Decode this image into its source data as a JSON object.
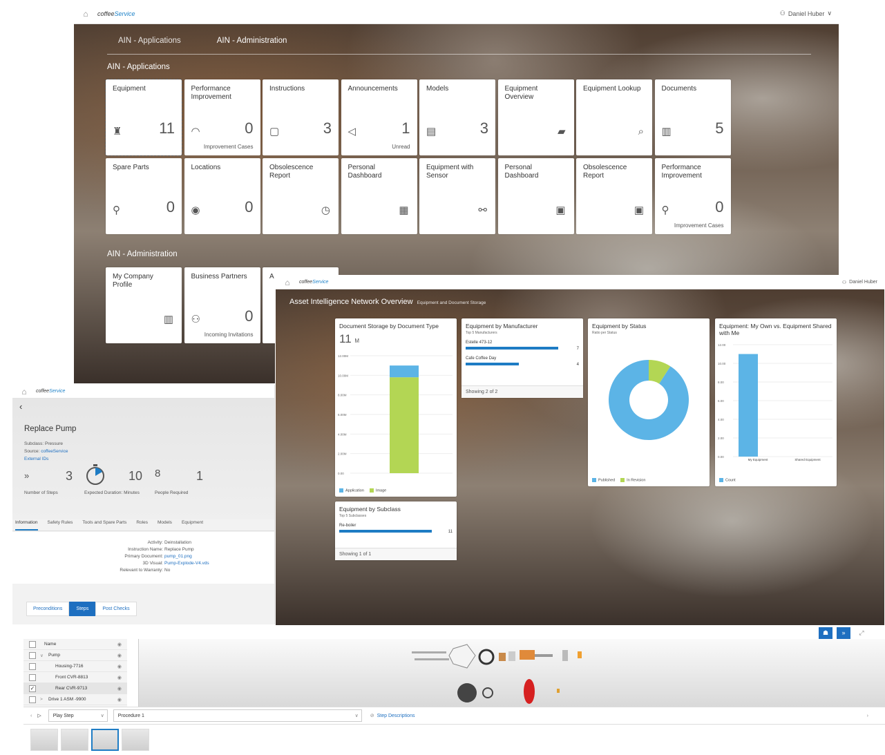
{
  "shell": {
    "brand_a": "coffee",
    "brand_b": "Service",
    "user": "Daniel Huber"
  },
  "launchpad": {
    "tabs": [
      "AIN - Applications",
      "AIN - Administration"
    ],
    "section_apps": "AIN - Applications",
    "section_admin": "AIN - Administration",
    "tiles_row1": [
      {
        "title": "Equipment",
        "icon": "equipment-icon",
        "value": "11",
        "sub": ""
      },
      {
        "title": "Performance Improvement",
        "icon": "gauge-icon",
        "value": "0",
        "sub": "Improvement Cases"
      },
      {
        "title": "Instructions",
        "icon": "cube-icon",
        "value": "3",
        "sub": ""
      },
      {
        "title": "Announcements",
        "icon": "megaphone-icon",
        "value": "1",
        "sub": "Unread"
      },
      {
        "title": "Models",
        "icon": "document-icon",
        "value": "3",
        "sub": ""
      },
      {
        "title": "Equipment Overview",
        "icon": "stack-icon",
        "value": "",
        "sub": ""
      },
      {
        "title": "Equipment Lookup",
        "icon": "doc-search-icon",
        "value": "",
        "sub": ""
      },
      {
        "title": "Documents",
        "icon": "documents-icon",
        "value": "5",
        "sub": ""
      }
    ],
    "tiles_row2": [
      {
        "title": "Spare Parts",
        "icon": "wrench-search-icon",
        "value": "0",
        "sub": ""
      },
      {
        "title": "Locations",
        "icon": "location-icon",
        "value": "0",
        "sub": ""
      },
      {
        "title": "Obsolescence Report",
        "icon": "trend-clock-icon",
        "value": "",
        "sub": ""
      },
      {
        "title": "Personal Dashboard",
        "icon": "dashboard-icon",
        "value": "",
        "sub": ""
      },
      {
        "title": "Equipment with Sensor",
        "icon": "sensor-icon",
        "value": "",
        "sub": ""
      },
      {
        "title": "Personal Dashboard",
        "icon": "checklist-icon",
        "value": "",
        "sub": ""
      },
      {
        "title": "Obsolescence Report",
        "icon": "checklist-icon",
        "value": "",
        "sub": ""
      },
      {
        "title": "Performance Improvement",
        "icon": "wrench-search-icon",
        "value": "0",
        "sub": "Improvement Cases"
      }
    ],
    "tiles_admin": [
      {
        "title": "My Company Profile",
        "icon": "building-icon",
        "value": "",
        "sub": ""
      },
      {
        "title": "Business Partners",
        "icon": "partners-icon",
        "value": "0",
        "sub": "Incoming Invitations"
      },
      {
        "title": "A",
        "icon": "",
        "value": "",
        "sub": ""
      }
    ]
  },
  "dashboard": {
    "title": "Asset Intelligence Network Overview",
    "subtitle": "Equipment and Document Storage",
    "doc_storage": {
      "title": "Document Storage by Document Type",
      "kpi": "11",
      "kpi_unit": "M",
      "legend": [
        "Application",
        "Image"
      ]
    },
    "manufacturer": {
      "title": "Equipment by Manufacturer",
      "sub": "Top 5 Manufacturers",
      "footer": "Showing 2 of 2"
    },
    "status": {
      "title": "Equipment by Status",
      "sub": "Ratio per Status",
      "legend": [
        "Published",
        "In Revision"
      ]
    },
    "shared": {
      "title": "Equipment: My Own vs. Equipment Shared with Me",
      "legend": [
        "Count"
      ]
    },
    "subclass": {
      "title": "Equipment by Subclass",
      "sub": "Top 5 Subclasses",
      "footer": "Showing 1 of 1"
    }
  },
  "chart_data": [
    {
      "type": "bar",
      "title": "Document Storage by Document Type",
      "categories": [
        ""
      ],
      "series": [
        {
          "name": "Application",
          "values": [
            1.2
          ]
        },
        {
          "name": "Image",
          "values": [
            9.8
          ]
        }
      ],
      "yticks": [
        "0.00",
        "2.00M",
        "4.00M",
        "6.00M",
        "8.00M",
        "10.00M",
        "12.00M"
      ],
      "ylim": [
        0,
        12
      ],
      "stacked": true
    },
    {
      "type": "bar",
      "title": "Equipment by Manufacturer",
      "categories": [
        "Estelle 473-12",
        "Cafe Coffee Day"
      ],
      "values": [
        7,
        4
      ],
      "orientation": "horizontal"
    },
    {
      "type": "pie",
      "title": "Equipment by Status",
      "categories": [
        "Published",
        "In Revision"
      ],
      "values": [
        10,
        1
      ],
      "donut": true
    },
    {
      "type": "bar",
      "title": "Equipment: My Own vs. Equipment Shared with Me",
      "categories": [
        "My Equipment",
        "Shared Equipment"
      ],
      "values": [
        11,
        0
      ],
      "yticks": [
        "0.00",
        "2.00",
        "4.00",
        "6.00",
        "8.00",
        "10.00",
        "12.00"
      ],
      "ylim": [
        0,
        12
      ]
    },
    {
      "type": "bar",
      "title": "Equipment by Subclass",
      "categories": [
        "Re-boiler"
      ],
      "values": [
        11
      ],
      "orientation": "horizontal"
    }
  ],
  "instruction": {
    "title": "Replace Pump",
    "subclass": "Subclass: Pressure",
    "source_label": "Source: ",
    "source_value": "coffeeService",
    "external_ids": "External IDs",
    "kpis": [
      {
        "value": "3",
        "label": "Number of Steps"
      },
      {
        "value": "10",
        "label": "Expected Duration: Minutes"
      },
      {
        "value": "1",
        "label": "People Required"
      }
    ],
    "tabs": [
      "Information",
      "Safety Rules",
      "Tools and Spare Parts",
      "Roles",
      "Models",
      "Equipment"
    ],
    "fields": [
      {
        "k": "Activity:",
        "v": "Deinstallation",
        "link": false
      },
      {
        "k": "Instruction Name:",
        "v": "Replace Pump",
        "link": false
      },
      {
        "k": "Primary Document:",
        "v": "pump_01.png",
        "link": true
      },
      {
        "k": "3D Visual:",
        "v": "Pump-Explode-V4.vds",
        "link": true
      },
      {
        "k": "Relevant to Warranty:",
        "v": "No",
        "link": false
      }
    ],
    "segments": [
      "Preconditions",
      "Steps",
      "Post Checks"
    ]
  },
  "viewer": {
    "tree_header": "Name",
    "tree": [
      {
        "label": "Pump",
        "indent": 1,
        "checked": false,
        "arrow": "∨"
      },
      {
        "label": "Housing-7716",
        "indent": 2,
        "checked": false,
        "arrow": ""
      },
      {
        "label": "Front CVR-8813",
        "indent": 2,
        "checked": false,
        "arrow": ""
      },
      {
        "label": "Rear CVR-9713",
        "indent": 2,
        "checked": true,
        "arrow": ""
      },
      {
        "label": "Drive 1 ASM -9900",
        "indent": 1,
        "checked": false,
        "arrow": ">"
      }
    ],
    "play_step": "Play Step",
    "procedure": "Procedure 1",
    "step_descriptions": "Step Descriptions"
  }
}
